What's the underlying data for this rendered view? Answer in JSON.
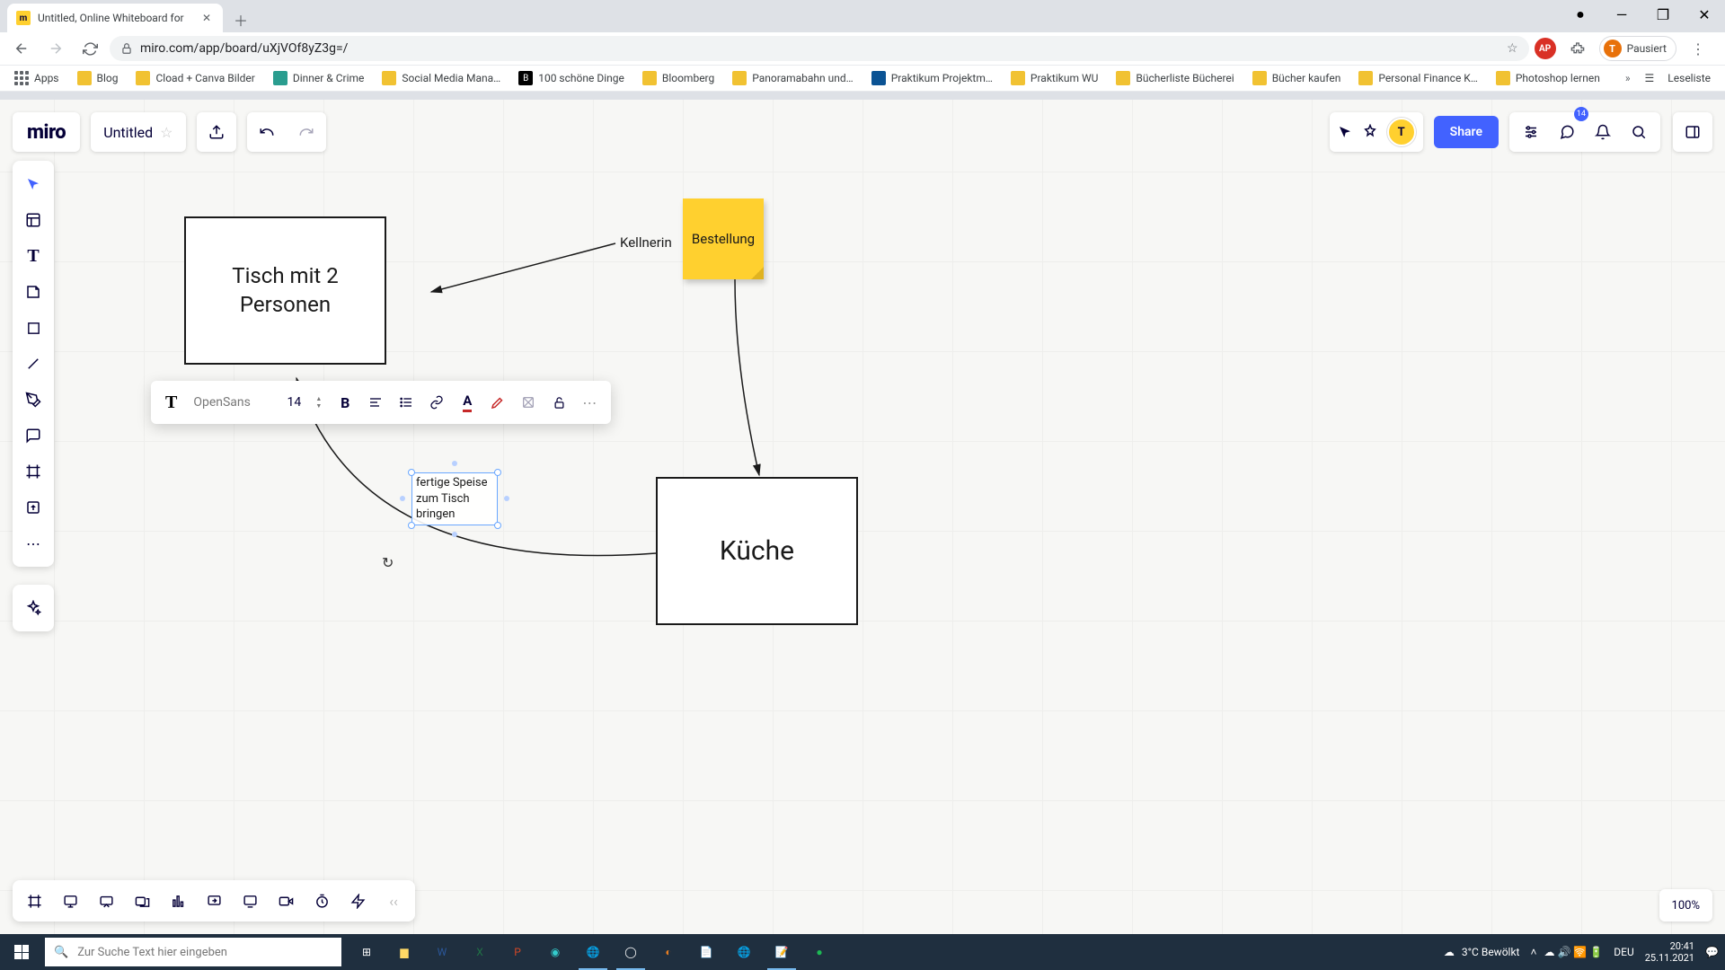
{
  "browser": {
    "tab_title": "Untitled, Online Whiteboard for",
    "url": "miro.com/app/board/uXjVOf8yZ3g=/",
    "profile_label": "Pausiert",
    "profile_initial": "T",
    "bookmarks": [
      "Apps",
      "Blog",
      "Cload + Canva Bilder",
      "Dinner & Crime",
      "Social Media Mana…",
      "100 schöne Dinge",
      "Bloomberg",
      "Panoramabahn und…",
      "Praktikum Projektm…",
      "Praktikum WU",
      "Bücherliste Bücherei",
      "Bücher kaufen",
      "Personal Finance K…",
      "Photoshop lernen"
    ],
    "bookmark_overflow": "Leseliste"
  },
  "miro": {
    "logo": "miro",
    "board_name": "Untitled",
    "share": "Share",
    "comment_badge": "14",
    "avatar_initial": "T",
    "zoom": "100%"
  },
  "text_toolbar": {
    "font": "OpenSans",
    "size": "14"
  },
  "canvas": {
    "box1": "Tisch mit 2 Personen",
    "box2": "Küche",
    "sticky": "Bestellung",
    "label_kellnerin": "Kellnerin",
    "selected_text": "fertige Speise zum Tisch bringen"
  },
  "taskbar": {
    "search_placeholder": "Zur Suche Text hier eingeben",
    "weather": "3°C  Bewölkt",
    "lang": "DEU",
    "time": "20:41",
    "date": "25.11.2021"
  }
}
